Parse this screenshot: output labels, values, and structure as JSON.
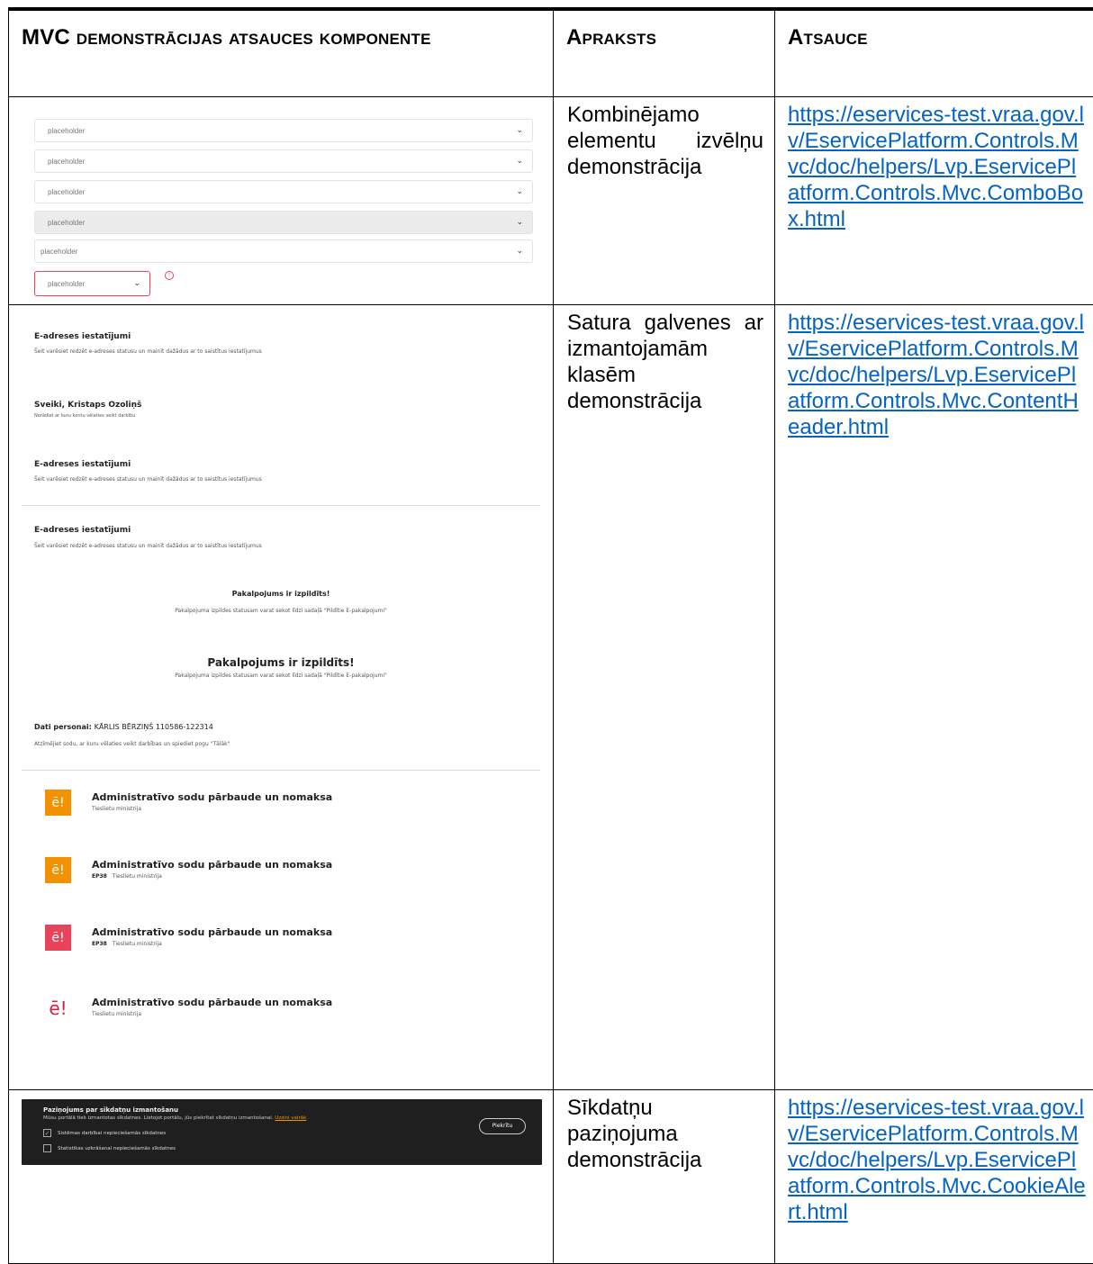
{
  "table": {
    "headers": [
      "MVC demonstrācijas atsauces komponente",
      "Apraksts",
      "Atsauce"
    ],
    "rows": [
      {
        "description": "Kombinējamo elementu izvēlņu demonstrācija",
        "link": "https://eservices-test.vraa.gov.lv/EservicePlatform.Controls.Mvc/doc/helpers/Lvp.EservicePlatform.Controls.Mvc.ComboBox.html"
      },
      {
        "description": "Satura galvenes ar izmantojamām klasēm demonstrācija",
        "link": "https://eservices-test.vraa.gov.lv/EservicePlatform.Controls.Mvc/doc/helpers/Lvp.EservicePlatform.Controls.Mvc.ContentHeader.html"
      },
      {
        "description": "Sīkdatņu paziņojuma demonstrācija",
        "link": "https://eservices-test.vraa.gov.lv/EservicePlatform.Controls.Mvc/doc/helpers/Lvp.EservicePlatform.Controls.Mvc.CookieAlert.html"
      }
    ]
  },
  "combo_demo": {
    "placeholder": "placeholder",
    "chevron_icon": "chevron-down-icon",
    "error_icon": "error-icon",
    "error_color": "#e8435a"
  },
  "header_demo": {
    "eaddr_title": "E-adreses iestatījumi",
    "eaddr_sub": "Šeit varēsiet redzēt e-adreses statusu un mainīt dažādus ar to saistītus iestatījumus",
    "greeting_title": "Sveiki, Kristaps Ozoliņš",
    "greeting_sub": "Norādiet ar kuru kontu vēlaties veikt darbību",
    "done_title": "Pakalpojums ir izpildīts!",
    "done_sub": "Pakalpojuma izpildes statusam varat sekot līdzi sadaļā \"Pildītie E-pakalpojumi\"",
    "person_label": "Dati personai:",
    "person_value": "KĀRLIS BĒRZIŅŠ 110586-122314",
    "person_sub": "Atzīmējiet sodu, ar kuru vēlaties veikt darbības un spiediet pogu \"Tālāk\"",
    "service_title": "Administratīvo sodu pārbaude un nomaksa",
    "service_org": "Tieslietu ministrija",
    "service_code": "EP38",
    "logo_text": "ē!",
    "brand_orange": "#f39200",
    "brand_red": "#e8435a"
  },
  "cookie_demo": {
    "title": "Paziņojums par sīkdatņu izmantošanu",
    "text": "Mūsu portālā tiek izmantotas sīkdatnes. Lietojot portālu, jūs piekrītat sīkdatņu izmantošanai.",
    "more_link": "Uzzini vairāk",
    "option1": "Sistēmas darbībai nepieciešamās sīkdatnes",
    "option2": "Statistikas uzkrāšanai nepieciešamās sīkdatnes",
    "accept": "Piekrītu",
    "background": "#1f1f1f"
  }
}
